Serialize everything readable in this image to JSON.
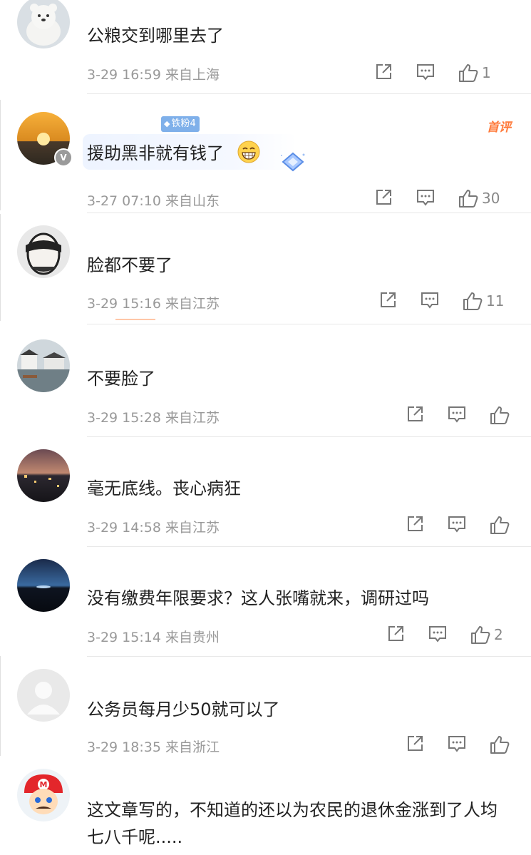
{
  "comments": [
    {
      "username": "",
      "text": "公粮交到哪里去了",
      "date": "3-29 16:59",
      "location": "来自上海",
      "likes": "1"
    },
    {
      "username": "",
      "fan_badge": "铁粉4",
      "first_comment": "首评",
      "text": "援助黑非就有钱了",
      "date": "3-27 07:10",
      "location": "来自山东",
      "likes": "30"
    },
    {
      "username": "",
      "text": "脸都不要了",
      "date": "3-29 15:16",
      "location": "来自江苏",
      "likes": "11"
    },
    {
      "username": "",
      "text": "不要脸了",
      "date": "3-29 15:28",
      "location": "来自江苏",
      "likes": ""
    },
    {
      "username": "",
      "text": "毫无底线。丧心病狂",
      "date": "3-29 14:58",
      "location": "来自江苏",
      "likes": ""
    },
    {
      "username": "",
      "text": "没有缴费年限要求？这人张嘴就来，调研过吗",
      "date": "3-29 15:14",
      "location": "来自贵州",
      "likes": "2"
    },
    {
      "username": "",
      "text": "公务员每月少50就可以了",
      "date": "3-29 18:35",
      "location": "来自浙江",
      "likes": ""
    },
    {
      "username": "",
      "text": "这文章写的，不知道的还以为农民的退休金涨到了人均七八千呢.....",
      "date": "",
      "location": "",
      "likes": ""
    }
  ],
  "icons": {
    "share": "share-icon",
    "reply": "comment-icon",
    "like": "thumbs-up-icon"
  },
  "colors": {
    "meta": "#999999",
    "badge": "#7fb0ea",
    "first_comment": "#ff7a3a"
  }
}
